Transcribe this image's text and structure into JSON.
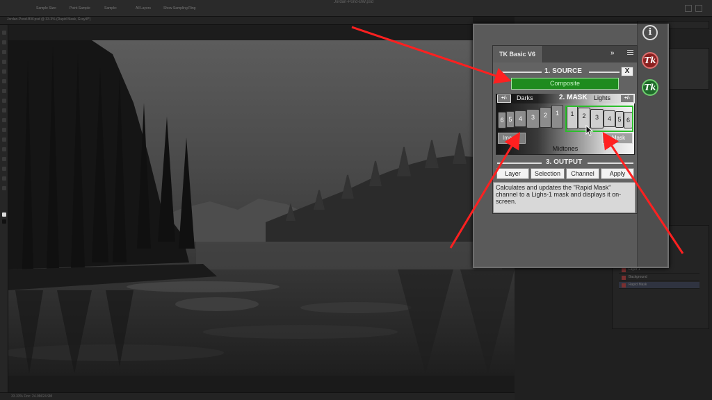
{
  "app": {
    "window_title": "Jordan-Pond-BW.psd",
    "doc_tab": "Jordan-Pond-BW.psd @ 33.3% (Rapid Mask, Gray/8*)",
    "options": [
      "Sample Size:",
      "Point Sample",
      "Sample:",
      "All Layers",
      "Show Sampling Ring"
    ],
    "status": "33.33%   Doc: 24.9M/24.9M",
    "layers": [
      "Rapid Mask",
      "Layer 1",
      "Background"
    ]
  },
  "tk_panel": {
    "tab_title": "TK Basic V6",
    "chevron": "»",
    "source": {
      "title": "1. SOURCE",
      "close_label": "X",
      "composite_label": "Composite"
    },
    "mask": {
      "title": "2. MASK",
      "darks_label": "Darks",
      "lights_label": "Lights",
      "darks_toggle": "+/-",
      "lights_toggle": "+/-",
      "dark_buttons": [
        "6",
        "5",
        "4",
        "3",
        "2",
        "1"
      ],
      "light_buttons": [
        "1",
        "2",
        "3",
        "4",
        "5",
        "6"
      ],
      "image_label": "Image",
      "mask_label": "Mask",
      "midtones_label": "Midtones"
    },
    "output": {
      "title": "3. OUTPUT",
      "layer_label": "Layer",
      "selection_label": "Selection",
      "channel_label": "Channel",
      "apply_label": "Apply"
    },
    "description": "Calculates and updates the \"Rapid Mask\" channel to a Lighs-1 mask and displays it on-screen."
  },
  "side_icons": {
    "info": "i",
    "tk_red": "Tk",
    "tk_green": "Tk"
  },
  "colors": {
    "accent_green": "#1e8b1e",
    "selection_outline": "#2bbf2b",
    "annotation_arrow": "#ff2020",
    "tk_red": "#8a2020"
  },
  "icons": [
    "info-icon",
    "tk-red-icon",
    "tk-green-icon",
    "chevron-double-right-icon",
    "hamburger-menu-icon",
    "cursor-arrow-icon",
    "annotation-arrow-icon"
  ]
}
